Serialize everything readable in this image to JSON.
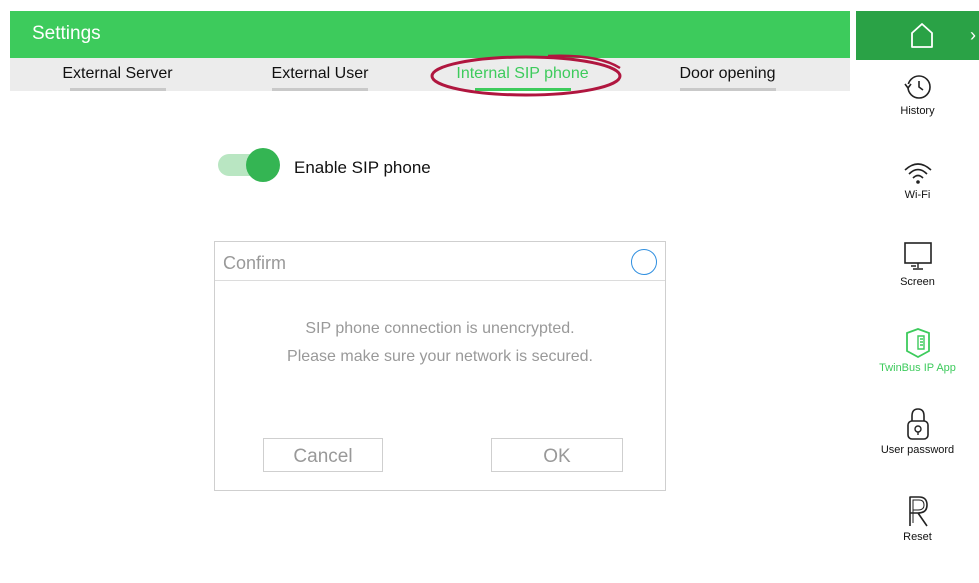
{
  "header": {
    "title": "Settings"
  },
  "tabs": [
    {
      "label": "External Server",
      "active": false
    },
    {
      "label": "External User",
      "active": false
    },
    {
      "label": "Internal SIP phone",
      "active": true
    },
    {
      "label": "Door opening",
      "active": false
    }
  ],
  "sip": {
    "toggle_label": "Enable SIP phone",
    "enabled": true
  },
  "dialog": {
    "title": "Confirm",
    "message_line1": "SIP phone connection is unencrypted.",
    "message_line2": "Please make sure your network is secured.",
    "cancel_label": "Cancel",
    "ok_label": "OK"
  },
  "sidebar": {
    "home_icon": "home-icon",
    "items": [
      {
        "label": "History",
        "icon": "history-icon"
      },
      {
        "label": "Wi-Fi",
        "icon": "wifi-icon"
      },
      {
        "label": "Screen",
        "icon": "screen-icon"
      },
      {
        "label": "TwinBus IP App",
        "icon": "app-icon",
        "active": true
      },
      {
        "label": "User password",
        "icon": "lock-icon"
      },
      {
        "label": "Reset",
        "icon": "reset-icon"
      }
    ]
  },
  "colors": {
    "accent": "#3dcb5c",
    "home_bg": "#2aa246",
    "annotation": "#b0163f",
    "close_ring": "#2f8fe0"
  }
}
